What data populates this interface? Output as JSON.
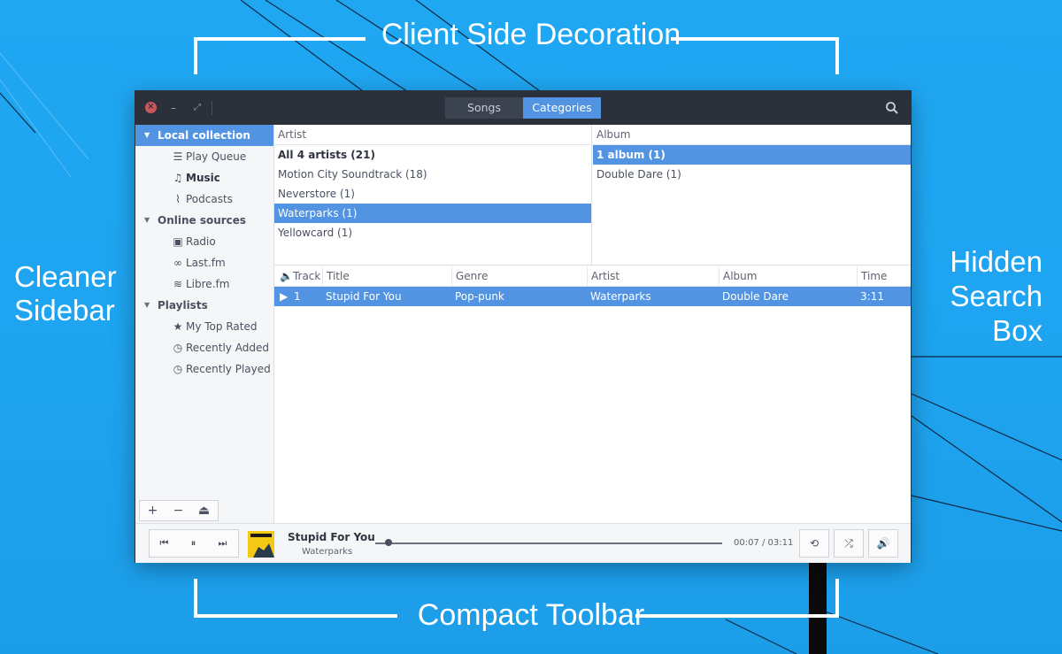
{
  "callouts": {
    "top": "Client Side Decoration",
    "bottom": "Compact Toolbar",
    "left": [
      "Cleaner",
      "Sidebar"
    ],
    "right": [
      "Hidden",
      "Search",
      "Box"
    ]
  },
  "titlebar": {
    "tabs": [
      "Songs",
      "Categories"
    ],
    "active_tab": "Categories",
    "close_glyph": "×",
    "min_glyph": "–",
    "max_glyph": "⤢"
  },
  "sidebar": {
    "sections": [
      {
        "label": "Local collection",
        "selected": true,
        "items": [
          {
            "label": "Play Queue",
            "icon": "queue-icon",
            "glyph": "☰"
          },
          {
            "label": "Music",
            "icon": "music-note-icon",
            "glyph": "♫",
            "bold": true
          },
          {
            "label": "Podcasts",
            "icon": "rss-icon",
            "glyph": "⌇"
          }
        ]
      },
      {
        "label": "Online sources",
        "items": [
          {
            "label": "Radio",
            "icon": "radio-icon",
            "glyph": "📻"
          },
          {
            "label": "Last.fm",
            "icon": "lastfm-icon",
            "glyph": "∞"
          },
          {
            "label": "Libre.fm",
            "icon": "wifi-icon",
            "glyph": "≋"
          }
        ]
      },
      {
        "label": "Playlists",
        "items": [
          {
            "label": "My Top Rated",
            "icon": "star-icon",
            "glyph": "★"
          },
          {
            "label": "Recently Added",
            "icon": "history-icon",
            "glyph": "◷"
          },
          {
            "label": "Recently Played",
            "icon": "history-icon",
            "glyph": "◷"
          }
        ]
      }
    ],
    "bottom_buttons": [
      "+",
      "−",
      "⏏"
    ]
  },
  "browser": {
    "artist_header": "Artist",
    "artists": [
      {
        "label": "All 4 artists (21)",
        "bold": true
      },
      {
        "label": "Motion City Soundtrack (18)"
      },
      {
        "label": "Neverstore (1)"
      },
      {
        "label": "Waterparks (1)",
        "selected": true
      },
      {
        "label": "Yellowcard (1)"
      }
    ],
    "album_header": "Album",
    "albums": [
      {
        "label": "1 album (1)",
        "bold": true,
        "selected": true
      },
      {
        "label": "Double Dare (1)"
      }
    ]
  },
  "tracklist": {
    "columns": [
      "Track",
      "Title",
      "Genre",
      "Artist",
      "Album",
      "Time"
    ],
    "rows": [
      {
        "track": "1",
        "title": "Stupid For You",
        "genre": "Pop-punk",
        "artist": "Waterparks",
        "album": "Double Dare",
        "time": "3:11",
        "playing": true
      }
    ]
  },
  "player": {
    "controls": [
      "⏮",
      "⏸",
      "⏭"
    ],
    "title": "Stupid For You",
    "artist": "Waterparks",
    "position": "00:07",
    "duration": "03:11",
    "time_display": "00:07 / 03:11",
    "progress": 0.037
  },
  "colors": {
    "accent": "#5294e2",
    "titlebar": "#2b303b",
    "background": "#1fa7f2",
    "close": "#cc575d"
  }
}
